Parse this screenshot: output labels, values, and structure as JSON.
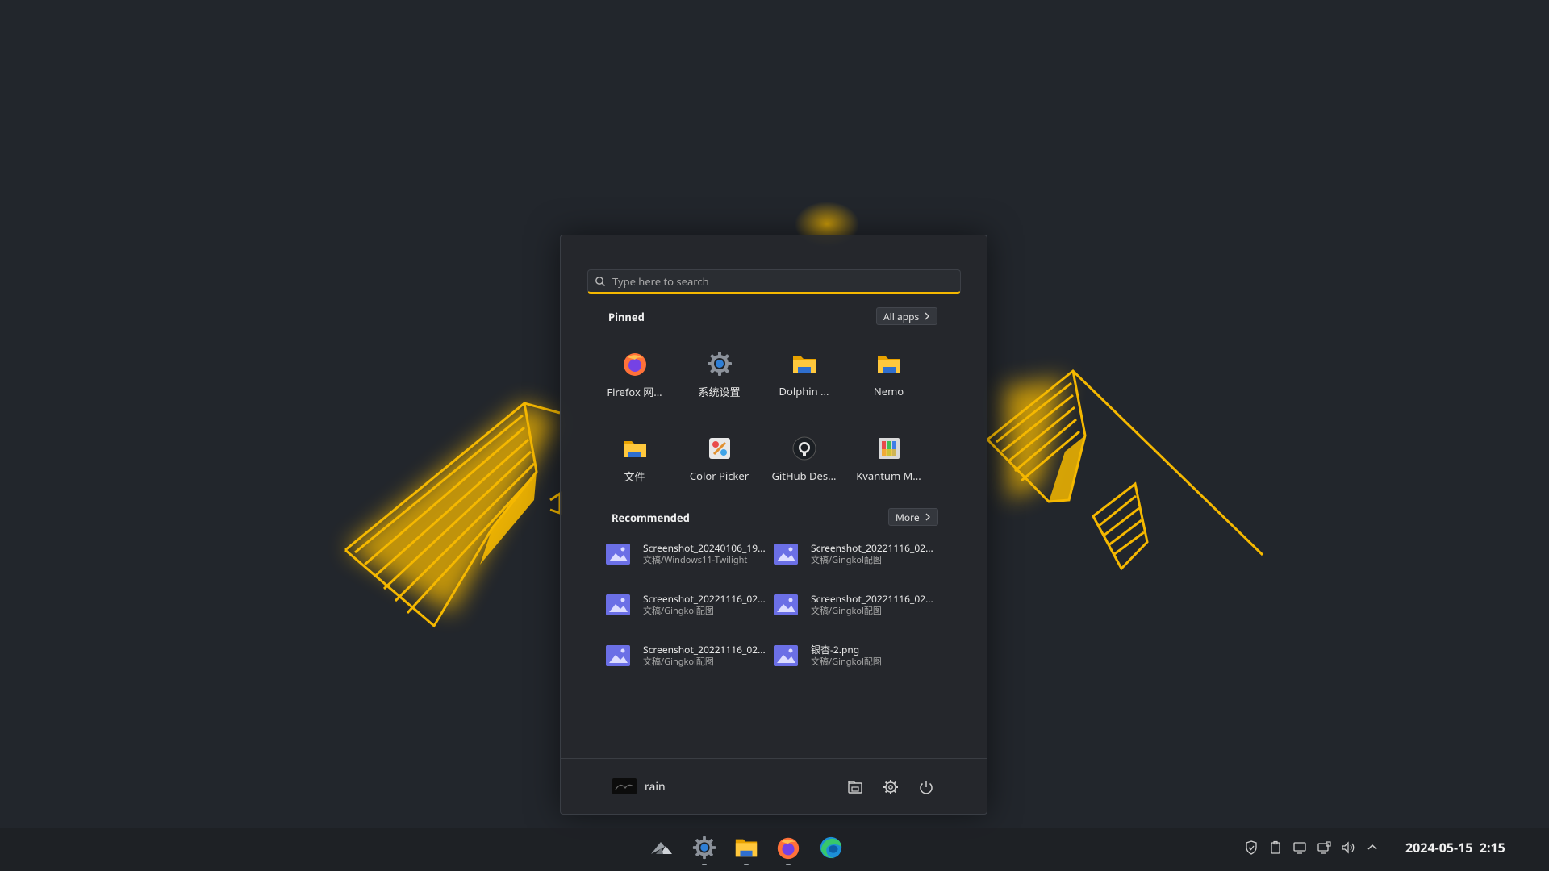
{
  "search": {
    "placeholder": "Type here to search"
  },
  "pinned": {
    "title": "Pinned",
    "all_apps_label": "All apps",
    "apps": [
      {
        "label": "Firefox 网...",
        "icon": "firefox-icon"
      },
      {
        "label": "系统设置",
        "icon": "settings-gear-icon"
      },
      {
        "label": "Dolphin ...",
        "icon": "folder-icon"
      },
      {
        "label": "Nemo",
        "icon": "folder-icon"
      },
      {
        "label": "文件",
        "icon": "folder-icon"
      },
      {
        "label": "Color Picker",
        "icon": "color-picker-icon"
      },
      {
        "label": "GitHub Des...",
        "icon": "github-icon"
      },
      {
        "label": "Kvantum M...",
        "icon": "kvantum-icon"
      }
    ]
  },
  "recommended": {
    "title": "Recommended",
    "more_label": "More",
    "items": [
      {
        "name": "Screenshot_20240106_19...",
        "path": "文稿/Windows11-Twilight"
      },
      {
        "name": "Screenshot_20221116_02...",
        "path": "文稿/Gingkol配图"
      },
      {
        "name": "Screenshot_20221116_02...",
        "path": "文稿/Gingkol配图"
      },
      {
        "name": "Screenshot_20221116_02...",
        "path": "文稿/Gingkol配图"
      },
      {
        "name": "Screenshot_20221116_02...",
        "path": "文稿/Gingkol配图"
      },
      {
        "name": "银杏-2.png",
        "path": "文稿/Gingkol配图"
      }
    ]
  },
  "user": {
    "name": "rain"
  },
  "taskbar": {
    "apps": [
      "start-logo-icon",
      "settings-gear-icon",
      "folder-icon",
      "firefox-icon",
      "edge-icon"
    ],
    "tray": [
      "shield-icon",
      "clipboard-icon",
      "display-icon",
      "network-icon",
      "volume-icon",
      "chevron-up-icon"
    ],
    "date": "2024-05-15",
    "time": "2:15"
  },
  "colors": {
    "accent": "#f5b800",
    "background": "#22262c",
    "file_icon": "#6b6fe6"
  }
}
